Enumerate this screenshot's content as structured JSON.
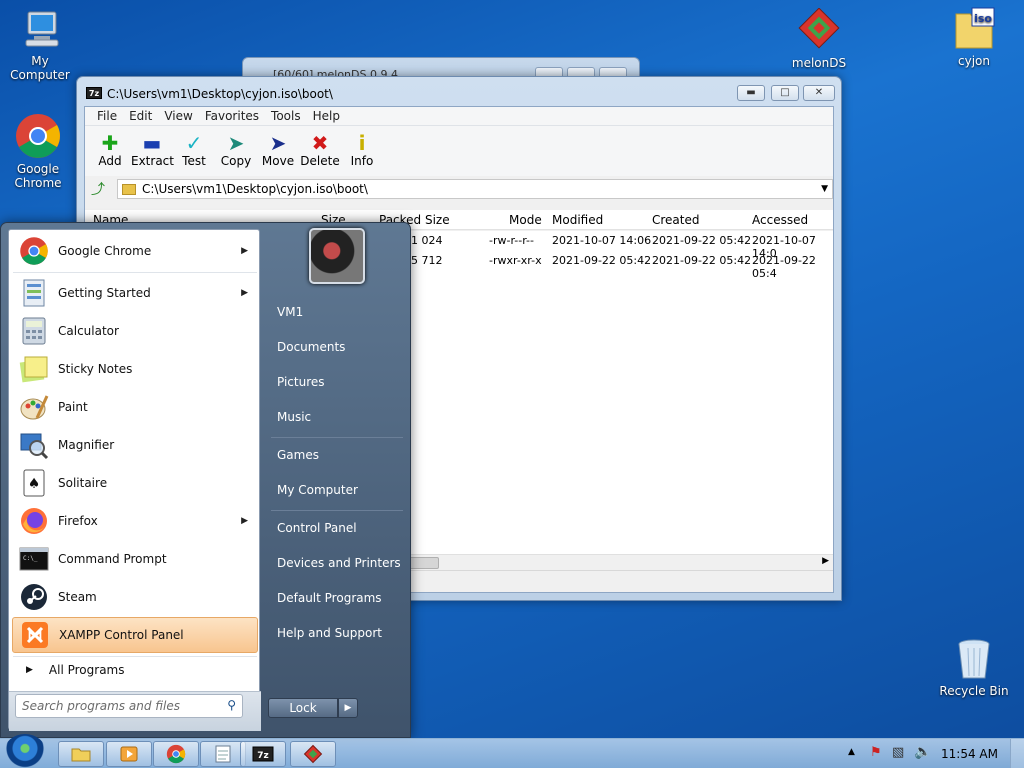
{
  "desktop": {
    "icons": [
      {
        "label": "My Computer"
      },
      {
        "label": "Google Chrome"
      },
      {
        "label": "melonDS"
      },
      {
        "label": "cyjon"
      },
      {
        "label": "Recycle Bin"
      }
    ]
  },
  "background_window": {
    "title": "[60/60] melonDS 0.9.4"
  },
  "window": {
    "title": "C:\\Users\\vm1\\Desktop\\cyjon.iso\\boot\\",
    "logo": "7z",
    "menu": [
      "File",
      "Edit",
      "View",
      "Favorites",
      "Tools",
      "Help"
    ],
    "toolbar": [
      {
        "label": "Add",
        "icon": "plus-icon",
        "color": "#1aa51a"
      },
      {
        "label": "Extract",
        "icon": "minus-icon",
        "color": "#1a3fb0"
      },
      {
        "label": "Test",
        "icon": "check-chevron-icon",
        "color": "#19b3c4"
      },
      {
        "label": "Copy",
        "icon": "arrow-right-icon",
        "color": "#1d8a7a"
      },
      {
        "label": "Move",
        "icon": "arrow-right-icon",
        "color": "#1a2f8c"
      },
      {
        "label": "Delete",
        "icon": "x-icon",
        "color": "#d11a1a"
      },
      {
        "label": "Info",
        "icon": "info-icon",
        "color": "#c8b000"
      }
    ],
    "address": "C:\\Users\\vm1\\Desktop\\cyjon.iso\\boot\\",
    "columns": [
      "Name",
      "Size",
      "Packed Size",
      "Mode",
      "Modified",
      "Created",
      "Accessed"
    ],
    "rows": [
      {
        "packed": "1 024",
        "mode": "-rw-r--r--",
        "modified": "2021-10-07 14:06",
        "created": "2021-09-22 05:42",
        "accessed": "2021-10-07 14:0"
      },
      {
        "packed": "5 712",
        "mode": "-rwxr-xr-x",
        "modified": "2021-09-22 05:42",
        "created": "2021-09-22 05:42",
        "accessed": "2021-09-22 05:4"
      }
    ]
  },
  "start_menu": {
    "programs": [
      {
        "label": "Google Chrome",
        "icon": "chrome-icon",
        "submenu": true
      },
      {
        "label": "Getting Started",
        "icon": "getting-started-icon",
        "submenu": true
      },
      {
        "label": "Calculator",
        "icon": "calculator-icon",
        "submenu": false
      },
      {
        "label": "Sticky Notes",
        "icon": "sticky-notes-icon",
        "submenu": false
      },
      {
        "label": "Paint",
        "icon": "paint-icon",
        "submenu": false
      },
      {
        "label": "Magnifier",
        "icon": "magnifier-icon",
        "submenu": false
      },
      {
        "label": "Solitaire",
        "icon": "solitaire-icon",
        "submenu": false
      },
      {
        "label": "Firefox",
        "icon": "firefox-icon",
        "submenu": true
      },
      {
        "label": "Command Prompt",
        "icon": "cmd-icon",
        "submenu": false
      },
      {
        "label": "Steam",
        "icon": "steam-icon",
        "submenu": false
      },
      {
        "label": "XAMPP Control Panel",
        "icon": "xampp-icon",
        "submenu": false,
        "selected": true
      }
    ],
    "all_programs": "All Programs",
    "search_placeholder": "Search programs and files",
    "right_items": [
      "VM1",
      "Documents",
      "Pictures",
      "Music",
      "Games",
      "My Computer",
      "Control Panel",
      "Devices and Printers",
      "Default Programs",
      "Help and Support"
    ],
    "lock_label": "Lock"
  },
  "taskbar": {
    "buttons": [
      "explorer-icon",
      "media-player-icon",
      "chrome-icon",
      "notepad-icon",
      "7zip-icon",
      "melonds-icon"
    ],
    "clock": "11:54 AM"
  }
}
